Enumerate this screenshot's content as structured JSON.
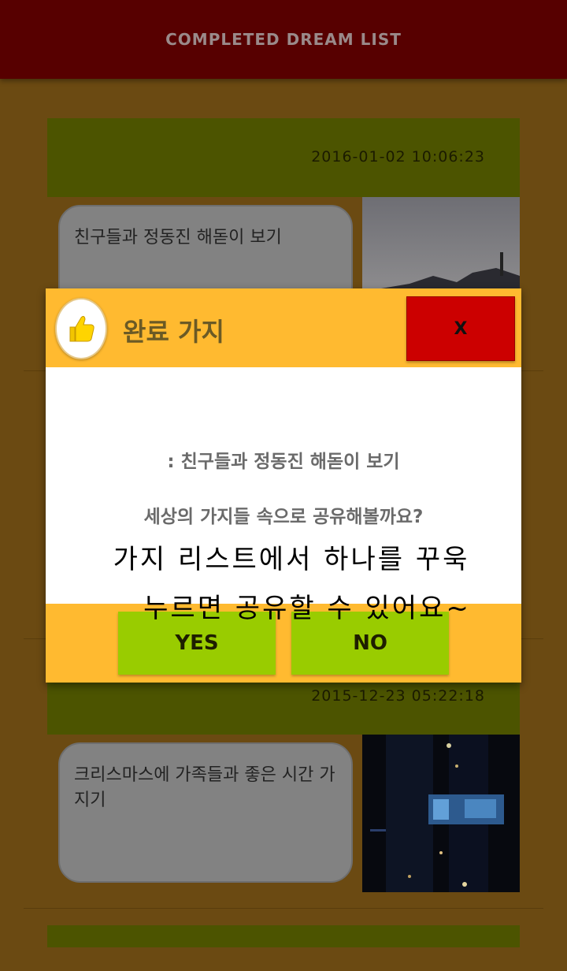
{
  "appbar": {
    "title": "COMPLETED DREAM LIST"
  },
  "cards": [
    {
      "date": "2016-01-02 10:06:23",
      "text": "친구들과 정동진 해돋이 보기"
    },
    {
      "date": "2015-12-23 05:22:18",
      "text": "크리스마스에 가족들과 좋은 시간 가지기"
    }
  ],
  "dialog": {
    "title": "완료 가지",
    "close_label": "X",
    "message_item": ": 친구들과 정동진 해돋이 보기",
    "message_question": "세상의 가지들 속으로 공유해볼까요?",
    "yes_label": "YES",
    "no_label": "NO"
  },
  "hint": {
    "line1": "가지 리스트에서 하나를 꾸욱",
    "line2": "누르면 공유할 수 있어요~"
  },
  "colors": {
    "appbar": "#570000",
    "background": "#6b4a12",
    "card_header": "#4c5400",
    "dialog_accent": "#ffba30",
    "close_button": "#cc0000",
    "action_button": "#99cc00"
  },
  "icons": {
    "dialog_icon": "thumbs-up-icon"
  }
}
